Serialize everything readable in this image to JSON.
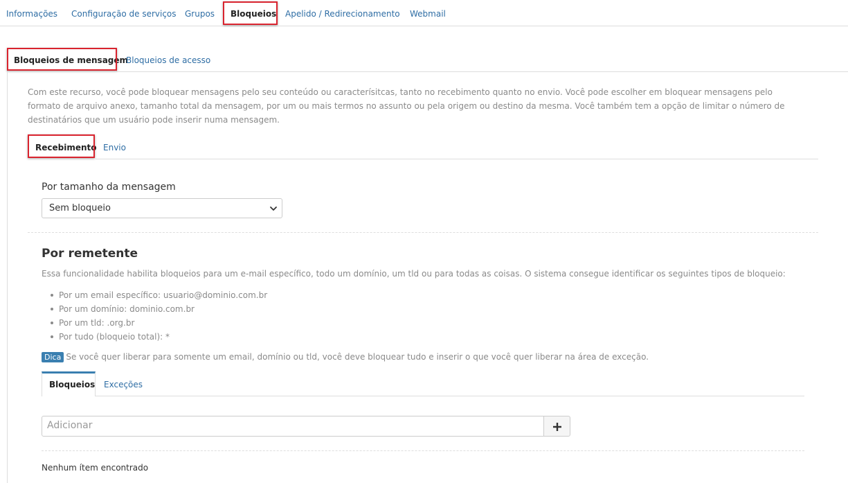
{
  "topnav": {
    "tabs": [
      {
        "label": "Informações"
      },
      {
        "label": "Configuração de serviços"
      },
      {
        "label": "Grupos"
      },
      {
        "label": "Bloqueios"
      },
      {
        "label": "Apelido / Redirecionamento"
      },
      {
        "label": "Webmail"
      }
    ],
    "active": "Bloqueios"
  },
  "block_tabs": {
    "message": "Bloqueios de mensagem",
    "access": "Bloqueios de acesso"
  },
  "intro_text": "Com este recurso, você pode bloquear mensagens pelo seu conteúdo ou caracterísitcas, tanto no recebimento quanto no envio. Você pode escolher em bloquear mensagens pelo formato de arquivo anexo, tamanho total da mensagem, por um ou mais termos no assunto ou pela origem ou destino da mesma. Você também tem a opção de limitar o número de destinatários que um usuário pode inserir numa mensagem.",
  "direction_tabs": {
    "receive": "Recebimento",
    "send": "Envio"
  },
  "size_block": {
    "label": "Por tamanho da mensagem",
    "selected": "Sem bloqueio"
  },
  "sender_block": {
    "title": "Por remetente",
    "description": "Essa funcionalidade habilita bloqueios para um e-mail específico, todo um domínio, um tld ou para todas as coisas. O sistema consegue identificar os seguintes tipos de bloqueio:",
    "types": [
      "Por um email específico: usuario@dominio.com.br",
      "Por um domínio: dominio.com.br",
      "Por um tld: .org.br",
      "Por tudo (bloqueio total): *"
    ],
    "tip_badge": "Dica",
    "tip_text": "Se você quer liberar para somente um email, domínio ou tld, você deve bloquear tudo e inserir o que você quer liberar na área de exceção.",
    "tabs": {
      "blocks": "Bloqueios",
      "exceptions": "Exceções"
    },
    "add_placeholder": "Adicionar",
    "empty_message": "Nenhum ítem encontrado"
  },
  "icons": {
    "add": "plus-icon",
    "select": "chevron-down-icon"
  },
  "colors": {
    "link": "#2e6da4",
    "highlight": "#d9232e",
    "badge": "#3a7fb0"
  }
}
